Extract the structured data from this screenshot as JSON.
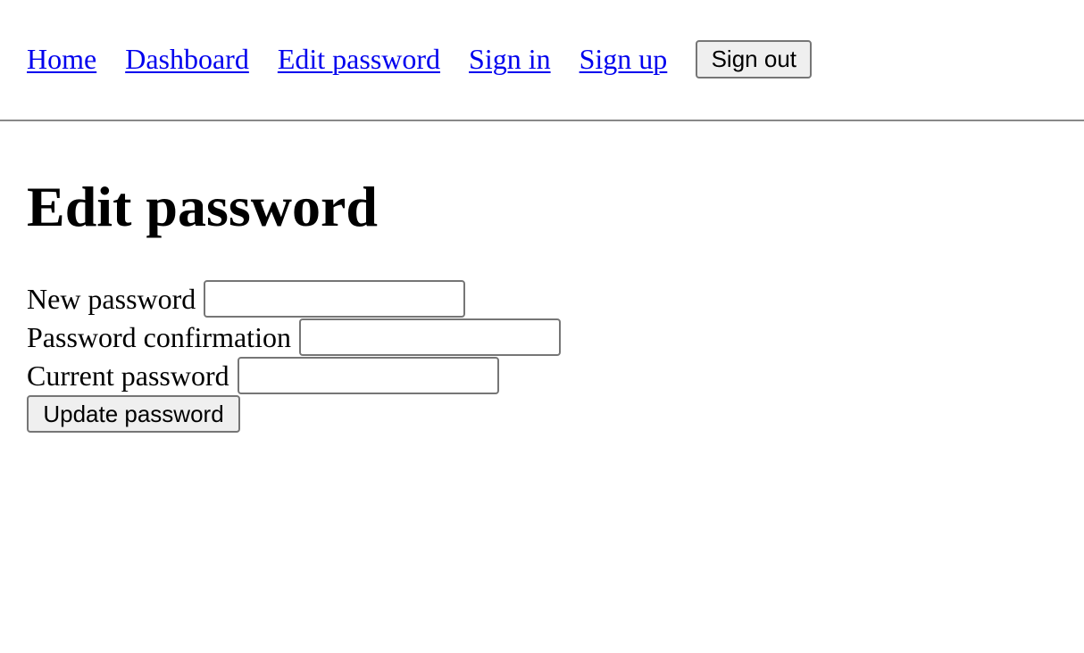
{
  "nav": {
    "links": [
      "Home",
      "Dashboard",
      "Edit password",
      "Sign in",
      "Sign up"
    ],
    "sign_out_label": "Sign out"
  },
  "page": {
    "title": "Edit password"
  },
  "form": {
    "new_password": {
      "label": "New password",
      "value": ""
    },
    "password_confirmation": {
      "label": "Password confirmation",
      "value": ""
    },
    "current_password": {
      "label": "Current password",
      "value": ""
    },
    "submit_label": "Update password"
  }
}
